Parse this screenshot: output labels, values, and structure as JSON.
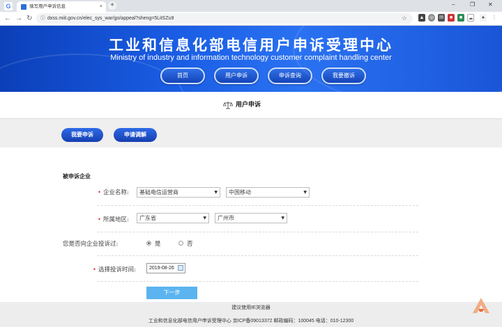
{
  "browser": {
    "tab_title": "填写用户申诉信息",
    "tab_close": "×",
    "new_tab": "+",
    "url": "dxss.miit.gov.cn/elec_sys_war/go/appeal?sheng=5LitSZu9",
    "window_controls": [
      "–",
      "❐",
      "✕"
    ]
  },
  "hero": {
    "title": "工业和信息化部电信用户申诉受理中心",
    "subtitle": "Ministry of industry and information technology customer complaint handling center",
    "nav": [
      "首页",
      "用户申诉",
      "申诉查询",
      "我要撤诉"
    ]
  },
  "page": {
    "title": "用户申诉"
  },
  "actions": {
    "appeal": "我要申诉",
    "mediation": "申请调解"
  },
  "form": {
    "section_title": "被申诉企业",
    "company_label": "企业名称:",
    "company_type": "基础电信运营商",
    "company_name": "中国移动",
    "region_label": "所属地区:",
    "province": "广东省",
    "city": "广州市",
    "prior_label": "您是否向企业投诉过:",
    "yes": "是",
    "no": "否",
    "time_label": "选择投诉时间:",
    "time_value": "2019-08-26",
    "next": "下一步",
    "required_mark": "•"
  },
  "footer": {
    "browser_hint": "建议使用IE浏览器",
    "info": "工业和信息化部电信用户申诉受理中心  京ICP备09013372  邮政编码：100045  电话：010-12300"
  },
  "colors": {
    "hero_blue": "#1a5de4",
    "button_blue": "#1a4fc8",
    "next_button": "#5bb4f0"
  }
}
